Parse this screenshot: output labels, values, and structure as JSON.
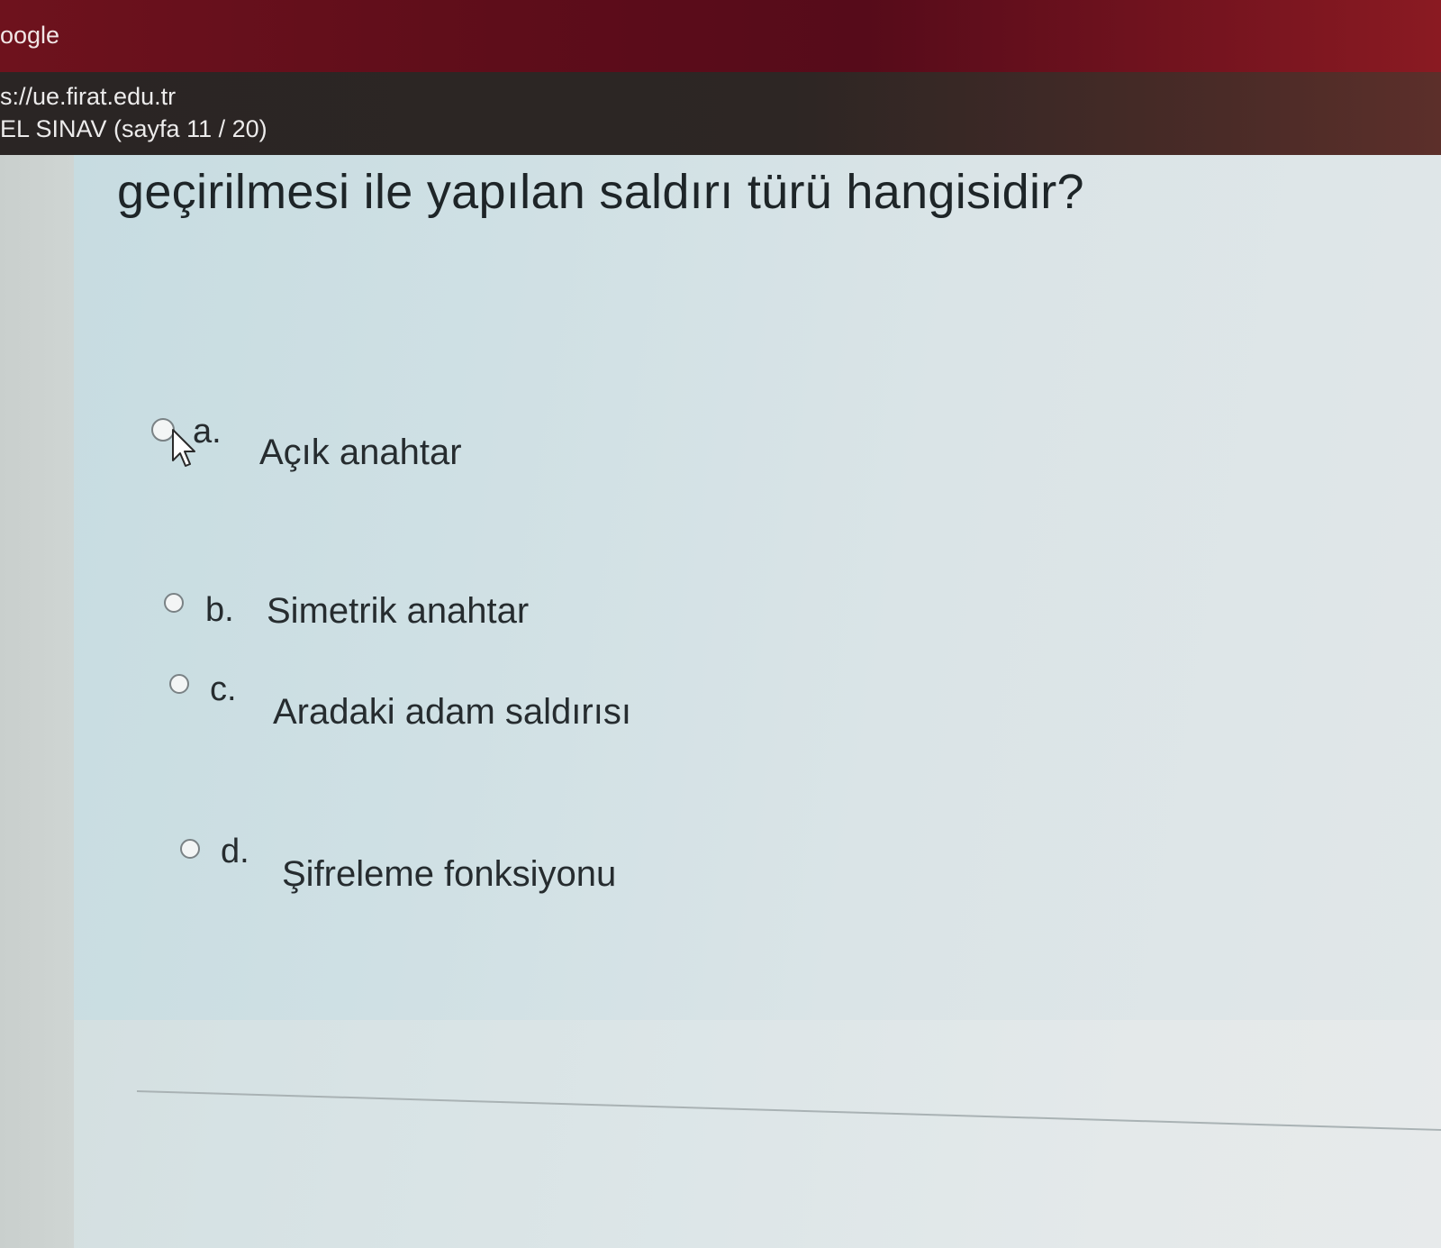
{
  "browser": {
    "app_title": "oogle",
    "url": "s://ue.firat.edu.tr",
    "page_title": "EL SINAV (sayfa 11 / 20)"
  },
  "question": {
    "text": "geçirilmesi ile yapılan saldırı türü hangisidir?"
  },
  "options": [
    {
      "letter": "a.",
      "label": "Açık anahtar"
    },
    {
      "letter": "b.",
      "label": "Simetrik anahtar"
    },
    {
      "letter": "c.",
      "label": "Aradaki adam saldırısı"
    },
    {
      "letter": "d.",
      "label": "Şifreleme fonksiyonu"
    }
  ],
  "colors": {
    "top_bar": "#6e121d",
    "address_bar": "#2a2524",
    "page_background": "#d6e2e4",
    "text": "#262c2f"
  },
  "icons": {
    "radio": "radio-button-icon",
    "cursor": "mouse-pointer-icon"
  }
}
